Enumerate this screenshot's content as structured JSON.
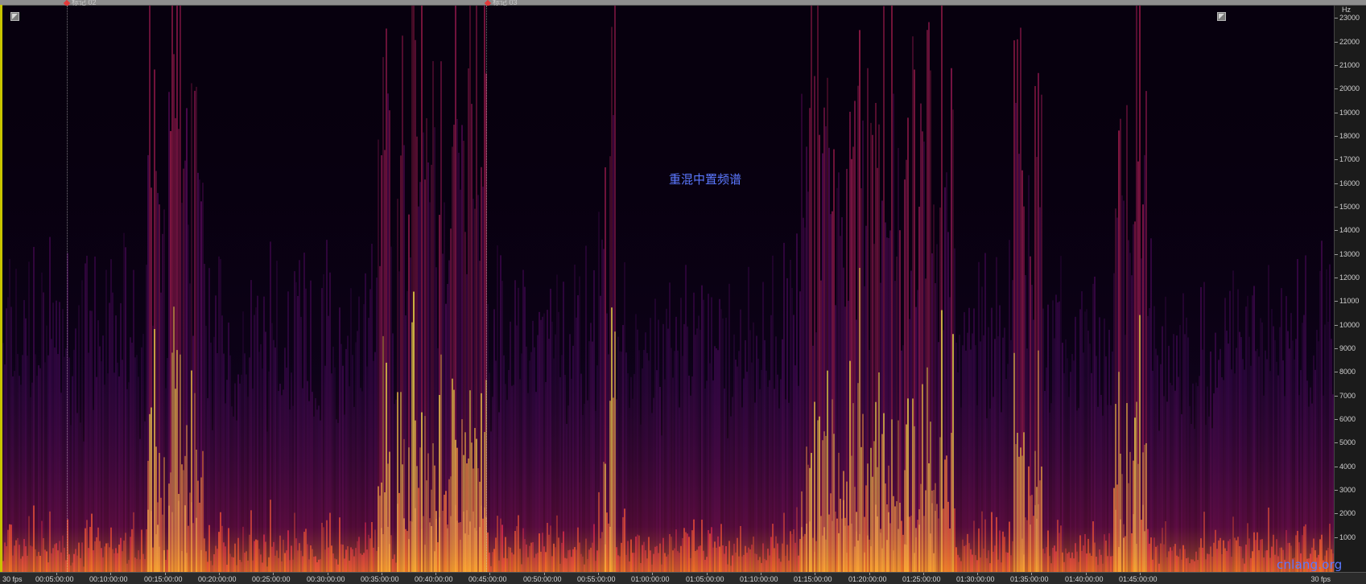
{
  "markers": [
    {
      "label": "标记 02",
      "time": "00:01:45"
    },
    {
      "label": "标记 03",
      "time": "00:44:30"
    }
  ],
  "view_label": "重混中置频谱",
  "watermark": "cnlang.org",
  "fps_label": "30 fps",
  "colors": {
    "background": "#07000e",
    "spectrum_low": "#2a0a4a",
    "spectrum_mid": "#d0205a",
    "spectrum_high": "#ffd24a",
    "view_label": "#5b78ff"
  },
  "icons": [
    "zoom-fit-icon-left",
    "zoom-fit-icon-right"
  ],
  "axes": {
    "y_unit": "Hz",
    "y_ticks": [
      23000,
      22000,
      21000,
      20000,
      19000,
      18000,
      17000,
      16000,
      15000,
      14000,
      13000,
      12000,
      11000,
      10000,
      9000,
      8000,
      7000,
      6000,
      5000,
      4000,
      3000,
      2000,
      1000
    ],
    "y_range": [
      0,
      24000
    ],
    "x_ticks": [
      "00:05:00:00",
      "00:10:00:00",
      "00:15:00:00",
      "00:20:00:00",
      "00:25:00:00",
      "00:30:00:00",
      "00:35:00:00",
      "00:40:00:00",
      "00:45:00:00",
      "00:50:00:00",
      "00:55:00:00",
      "01:00:00:00",
      "01:05:00:00",
      "01:10:00:00",
      "01:15:00:00",
      "01:20:00:00",
      "01:25:00:00",
      "01:30:00:00",
      "01:35:00:00",
      "01:40:00:00",
      "01:45:00:00"
    ]
  }
}
